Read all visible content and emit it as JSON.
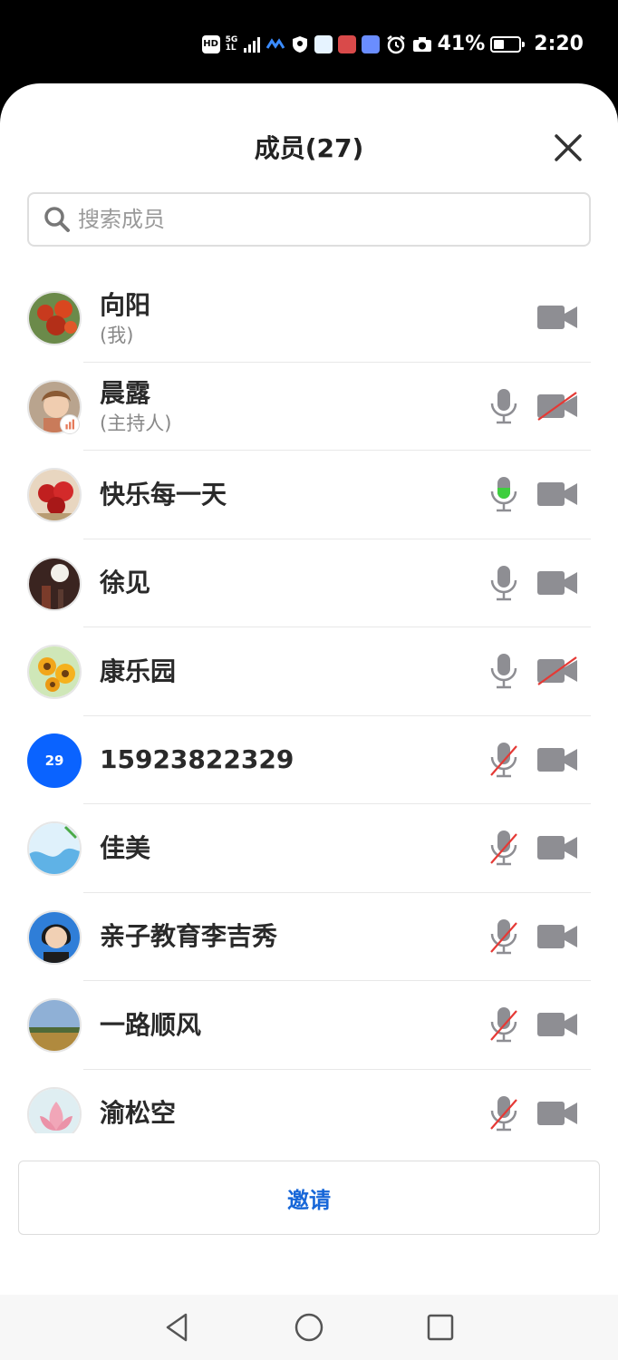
{
  "status_bar": {
    "network_badge": "HD",
    "network_type": "5G",
    "network_sub": "1L",
    "battery_text": "41%",
    "time": "2:20"
  },
  "header": {
    "title": "成员(27)"
  },
  "search": {
    "placeholder": "搜索成员",
    "value": ""
  },
  "members": [
    {
      "name": "向阳",
      "sub": "(我)",
      "avatar": "red-flowers",
      "mic": "none",
      "camera": "on"
    },
    {
      "name": "晨露",
      "sub": "(主持人)",
      "avatar": "child-photo",
      "mic": "on",
      "camera": "off",
      "host_badge": true
    },
    {
      "name": "快乐每一天",
      "sub": "",
      "avatar": "rose-bouquet",
      "mic": "speaking",
      "camera": "on"
    },
    {
      "name": "徐见",
      "sub": "",
      "avatar": "lamp-room",
      "mic": "on",
      "camera": "on"
    },
    {
      "name": "康乐园",
      "sub": "",
      "avatar": "sunflowers",
      "mic": "on",
      "camera": "off"
    },
    {
      "name": "15923822329",
      "sub": "",
      "avatar_text": "29",
      "mic": "muted",
      "camera": "on"
    },
    {
      "name": "佳美",
      "sub": "",
      "avatar": "water-splash",
      "mic": "muted",
      "camera": "on"
    },
    {
      "name": "亲子教育李吉秀",
      "sub": "",
      "avatar": "woman-portrait",
      "mic": "muted",
      "camera": "on"
    },
    {
      "name": "一路顺风",
      "sub": "",
      "avatar": "landscape",
      "mic": "muted",
      "camera": "on"
    },
    {
      "name": "渝松空",
      "sub": "",
      "avatar": "lotus",
      "mic": "muted",
      "camera": "on"
    }
  ],
  "invite_label": "邀请",
  "colors": {
    "accent_blue": "#1666d8",
    "avatar_blue": "#0a63ff",
    "speaking_green": "#3ecf3e",
    "muted_red": "#e53935",
    "icon_gray": "#8e8e93"
  },
  "icons": {
    "close": "close-icon",
    "search": "search-icon",
    "mic": "microphone-icon",
    "camera": "video-camera-icon",
    "nav_back": "triangle-back-icon",
    "nav_home": "circle-home-icon",
    "nav_recent": "square-recent-icon"
  }
}
